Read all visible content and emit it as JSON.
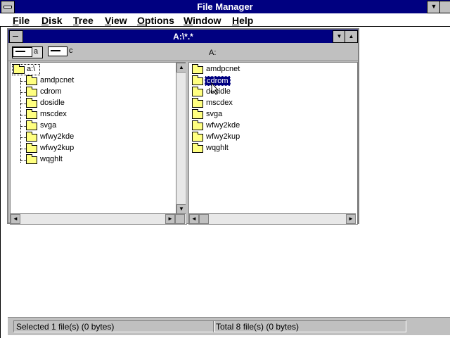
{
  "app": {
    "title": "File Manager"
  },
  "menu": [
    "File",
    "Disk",
    "Tree",
    "View",
    "Options",
    "Window",
    "Help"
  ],
  "child_window": {
    "title": "A:\\*.*"
  },
  "drives": [
    {
      "letter": "a"
    },
    {
      "letter": "c"
    }
  ],
  "drive_path": "A:",
  "tree": {
    "root": "a:\\",
    "folders": [
      "amdpcnet",
      "cdrom",
      "dosidle",
      "mscdex",
      "svga",
      "wfwy2kde",
      "wfwy2kup",
      "wqghlt"
    ]
  },
  "files": {
    "items": [
      "amdpcnet",
      "cdrom",
      "dosidle",
      "mscdex",
      "svga",
      "wfwy2kde",
      "wfwy2kup",
      "wqghlt"
    ],
    "selected": "cdrom"
  },
  "status": {
    "selected": "Selected 1 file(s) (0 bytes)",
    "total": "Total 8 file(s) (0 bytes)"
  },
  "icons": [
    "folder-icon",
    "drive-icon",
    "scroll-up-icon",
    "scroll-down-icon",
    "scroll-left-icon",
    "scroll-right-icon"
  ]
}
